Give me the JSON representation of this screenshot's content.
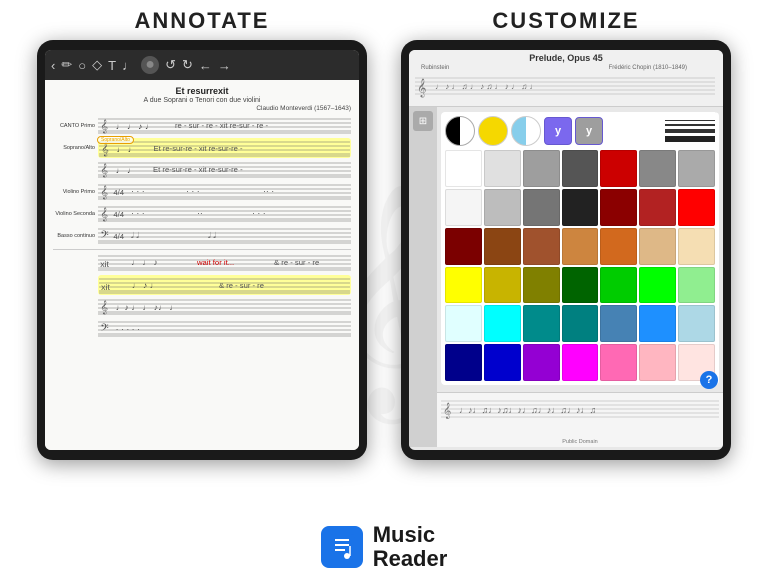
{
  "page": {
    "background": "#ffffff"
  },
  "annotate": {
    "section_title": "ANNOTATE",
    "sheet": {
      "title": "Et resurrexit",
      "subtitle": "A due Soprani o Tenori con due violini",
      "composer": "Claudio Monteverdi (1567–1643)",
      "rows": [
        {
          "label": "CANTO Primo",
          "highlighted": false
        },
        {
          "label": "Soprano/Alto",
          "highlighted": true,
          "annotation": "Soprano/Alto"
        },
        {
          "label": "",
          "highlighted": false
        },
        {
          "label": "Violino Primo",
          "highlighted": false
        },
        {
          "label": "Violino Seconda",
          "highlighted": false
        },
        {
          "label": "Basso continuo",
          "highlighted": false
        }
      ],
      "red_text": "wait for it..."
    }
  },
  "customize": {
    "section_title": "CUSTOMIZE",
    "sheet": {
      "title": "Prelude, Opus 45",
      "composer": "Frédéric Chopin (1810–1849)",
      "subtitle_left": "Rubinstein"
    },
    "color_grid": {
      "top_circles": [
        {
          "color": "#ffffff",
          "border": "#aaa"
        },
        {
          "color": "#f5d800",
          "border": "#ccc"
        },
        {
          "color": "#87ceeb",
          "border": "#ccc"
        }
      ],
      "y_buttons": [
        {
          "color": "#7b68ee",
          "label": "y"
        },
        {
          "color": "#9e9e9e",
          "label": "y"
        }
      ],
      "line_samples": [
        {
          "height": 1,
          "color": "#333"
        },
        {
          "height": 2,
          "color": "#333"
        },
        {
          "height": 4,
          "color": "#333"
        },
        {
          "height": 6,
          "color": "#333"
        }
      ],
      "swatches": [
        "#ffffff",
        "#e0e0e0",
        "#9e9e9e",
        "#555555",
        "#cc0000",
        "#888888",
        "#aaaaaa",
        "#f5f5f5",
        "#bdbdbd",
        "#757575",
        "#222222",
        "#8b0000",
        "#b22222",
        "#ff0000",
        "#7b0000",
        "#8b4513",
        "#a0522d",
        "#cd853f",
        "#d2691e",
        "#deb887",
        "#f5deb3",
        "#ffff00",
        "#c8b400",
        "#808000",
        "#006400",
        "#00cc00",
        "#00ff00",
        "#90ee90",
        "#e0ffff",
        "#00ffff",
        "#008b8b",
        "#008080",
        "#4682b4",
        "#1e90ff",
        "#add8e6",
        "#00008b",
        "#0000cd",
        "#9400d3",
        "#ff00ff",
        "#ff69b4",
        "#ffb6c1",
        "#ffe4e1"
      ]
    },
    "bottom_text": "Public Domain",
    "close_label": "✕",
    "help_label": "?"
  },
  "branding": {
    "app_name_line1": "Music",
    "app_name_line2": "Reader",
    "logo_icon": "♪"
  },
  "watermark": {
    "symbol": "𝄞"
  }
}
